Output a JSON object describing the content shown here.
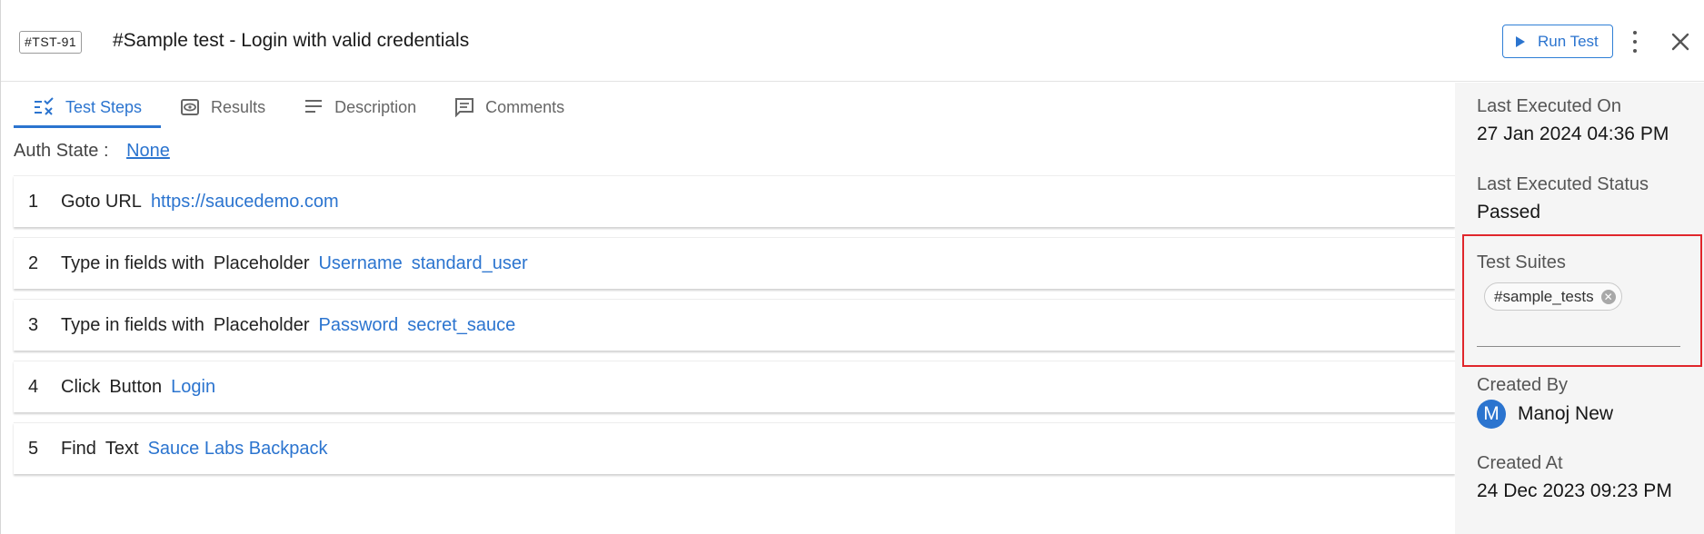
{
  "header": {
    "test_id": "#TST-91",
    "title": "#Sample test - Login with valid credentials",
    "run_label": "Run Test"
  },
  "tabs": [
    {
      "label": "Test Steps",
      "icon": "steps-check-icon",
      "active": true
    },
    {
      "label": "Results",
      "icon": "eye-icon",
      "active": false
    },
    {
      "label": "Description",
      "icon": "lines-icon",
      "active": false
    },
    {
      "label": "Comments",
      "icon": "comment-icon",
      "active": false
    }
  ],
  "auth": {
    "label": "Auth State :",
    "value": "None"
  },
  "steps": [
    {
      "num": "1",
      "parts": [
        "Goto URL"
      ],
      "values": [
        "https://saucedemo.com"
      ]
    },
    {
      "num": "2",
      "parts": [
        "Type in fields with",
        "Placeholder"
      ],
      "values": [
        "Username",
        "standard_user"
      ]
    },
    {
      "num": "3",
      "parts": [
        "Type in fields with",
        "Placeholder"
      ],
      "values": [
        "Password",
        "secret_sauce"
      ]
    },
    {
      "num": "4",
      "parts": [
        "Click",
        "Button"
      ],
      "values": [
        "Login"
      ]
    },
    {
      "num": "5",
      "parts": [
        "Find",
        "Text"
      ],
      "values": [
        "Sauce Labs Backpack"
      ]
    }
  ],
  "side": {
    "last_executed_on_label": "Last Executed On",
    "last_executed_on": "27 Jan 2024 04:36 PM",
    "last_status_label": "Last Executed Status",
    "last_status": "Passed",
    "suites_label": "Test Suites",
    "suite_chip": "#sample_tests",
    "created_by_label": "Created By",
    "created_by_initial": "M",
    "created_by": "Manoj New",
    "created_at_label": "Created At",
    "created_at": "24 Dec 2023 09:23 PM"
  },
  "colors": {
    "accent": "#2b74cf",
    "highlight": "#e0262b",
    "panel": "#f5f5f5"
  }
}
